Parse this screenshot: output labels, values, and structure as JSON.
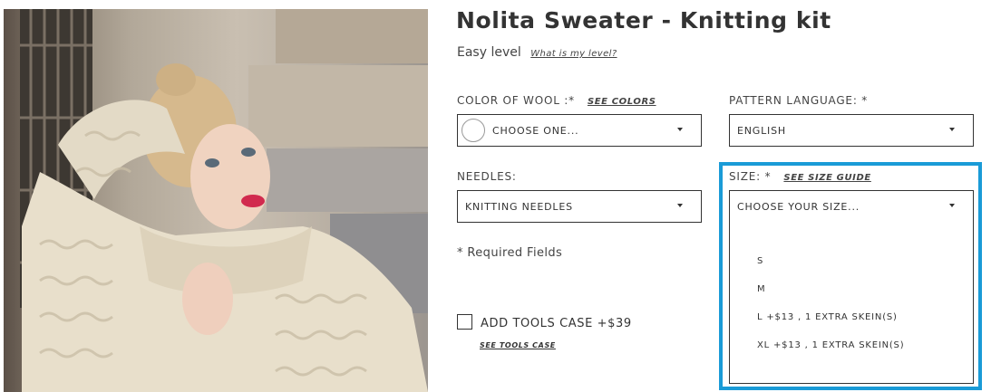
{
  "social": {
    "facebook_icon": "facebook-icon",
    "twitter_icon": "twitter-icon",
    "pinterest_icon": "pinterest-icon"
  },
  "product": {
    "title": "Nolita Sweater - Knitting kit",
    "level": "Easy level",
    "level_link": "What is my level?"
  },
  "color_of_wool": {
    "label": "COLOR OF WOOL :*",
    "link": "SEE COLORS",
    "value": "CHOOSE ONE..."
  },
  "pattern_language": {
    "label": "PATTERN LANGUAGE: *",
    "value": "ENGLISH"
  },
  "needles": {
    "label": "NEEDLES:",
    "value": "KNITTING NEEDLES"
  },
  "size": {
    "label": "SIZE: *",
    "link": "SEE SIZE GUIDE",
    "value": "CHOOSE YOUR SIZE...",
    "options": [
      "S",
      "M",
      "L +$13 , 1 EXTRA SKEIN(S)",
      "XL +$13 , 1 EXTRA SKEIN(S)"
    ]
  },
  "required_note": "* Required Fields",
  "tools_case": {
    "label": "ADD TOOLS CASE +$39",
    "link": "SEE TOOLS CASE"
  },
  "colors": {
    "highlight": "#1a9bd7",
    "text": "#333333"
  }
}
